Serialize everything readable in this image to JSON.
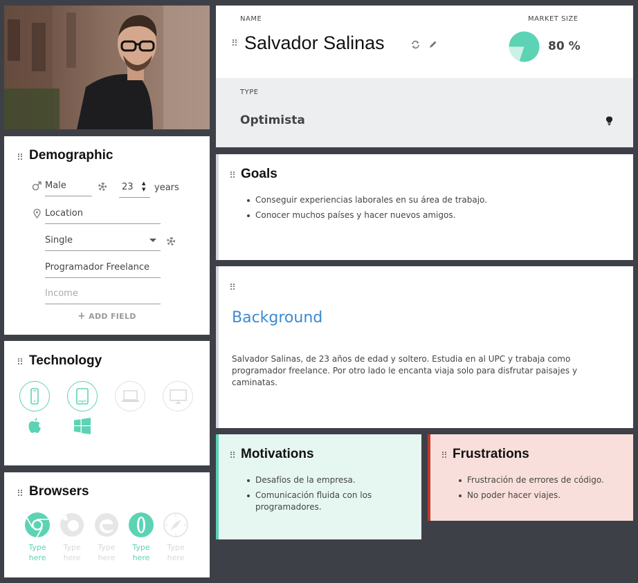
{
  "persona": {
    "name_label": "NAME",
    "name": "Salvador Salinas",
    "market_label": "MARKET SIZE",
    "market_value": "80 %",
    "market_fraction": 0.8,
    "type_label": "TYPE",
    "type": "Optimista"
  },
  "demographic": {
    "title": "Demographic",
    "gender": "Male",
    "age": "23",
    "age_unit": "years",
    "location": "Location",
    "status": "Single",
    "occupation": "Programador Freelance",
    "income_placeholder": "Income",
    "add_field": "ADD FIELD"
  },
  "technology": {
    "title": "Technology",
    "devices": [
      {
        "name": "phone",
        "active": true
      },
      {
        "name": "tablet",
        "active": true
      },
      {
        "name": "laptop",
        "active": false
      },
      {
        "name": "desktop",
        "active": false
      }
    ],
    "os": [
      "apple-icon",
      "windows-icon"
    ]
  },
  "browsers": {
    "title": "Browsers",
    "items": [
      {
        "icon": "chrome-icon",
        "label": "Type here",
        "active": true
      },
      {
        "icon": "firefox-icon",
        "label": "Type here",
        "active": false
      },
      {
        "icon": "edge-icon",
        "label": "Type here",
        "active": false
      },
      {
        "icon": "opera-icon",
        "label": "Type here",
        "active": true
      },
      {
        "icon": "safari-icon",
        "label": "Type here",
        "active": false
      }
    ]
  },
  "goals": {
    "title": "Goals",
    "items": [
      "Conseguir experiencias laborales en su área de trabajo.",
      "Conocer muchos países y hacer nuevos amigos."
    ]
  },
  "background": {
    "title": "Background",
    "text": "Salvador Salinas, de 23 años de edad y soltero. Estudia en al UPC  y trabaja como programador freelance. Por otro lado le encanta viaja solo para disfrutar paisajes y caminatas."
  },
  "motivations": {
    "title": "Motivations",
    "items": [
      "Desafíos de la empresa.",
      "Comunicación fluida con los programadores."
    ]
  },
  "frustrations": {
    "title": "Frustrations",
    "items": [
      "Frustración de errores de código.",
      "No poder hacer viajes."
    ]
  },
  "colors": {
    "accent": "#5cd3b4",
    "link": "#3b8ad0",
    "motivations_bg": "#e6f7f2",
    "frustrations_bg": "#f9dfdb",
    "frustrations_bar": "#c0392b",
    "page_bg": "#3e4047"
  }
}
